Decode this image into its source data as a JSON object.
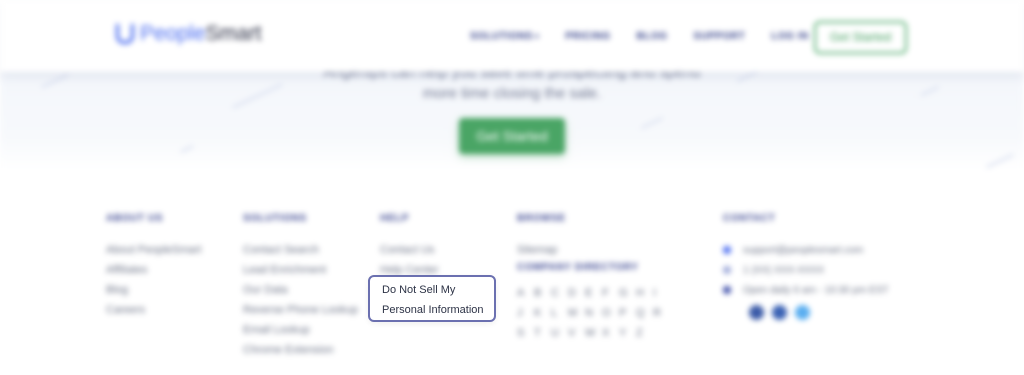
{
  "header": {
    "logo_people": "People",
    "logo_smart": "Smart",
    "nav": [
      "SOLUTIONS",
      "PRICING",
      "BLOG",
      "SUPPORT",
      "LOG IN"
    ],
    "nav_caret": "▾",
    "cta": "Get Started"
  },
  "hero": {
    "line1": "Angertips can help you save time prospecting and spend",
    "line2": "more time closing the sale.",
    "cta": "Get Started"
  },
  "footer": {
    "about": {
      "title": "ABOUT US",
      "links": [
        "About PeopleSmart",
        "Affiliates",
        "Blog",
        "Careers"
      ]
    },
    "solutions": {
      "title": "SOLUTIONS",
      "links": [
        "Contact Search",
        "Lead Enrichment",
        "Our Data",
        "Reverse Phone Lookup",
        "Email Lookup",
        "Chrome Extension"
      ]
    },
    "help": {
      "title": "HELP",
      "links": [
        "Contact Us",
        "Help Center"
      ]
    },
    "browse": {
      "title": "BROWSE",
      "links": [
        "Sitemap"
      ],
      "directory_title": "COMPANY DIRECTORY",
      "letters": [
        "A",
        "B",
        "C",
        "D",
        "E",
        "F",
        "G",
        "H",
        "I",
        "J",
        "K",
        "L",
        "M",
        "N",
        "O",
        "P",
        "Q",
        "R",
        "S",
        "T",
        "U",
        "V",
        "W",
        "X",
        "Y",
        "Z"
      ]
    },
    "contact": {
      "title": "CONTACT",
      "email": "support@peoplesmart.com",
      "phone": "1 (XX) XXX-XXXX",
      "hours": "Open daily 6 am - 10:30 pm EST"
    }
  },
  "tooltip": {
    "line1": "Do Not Sell My",
    "line2": "Personal Information"
  },
  "colors": {
    "brand_blue": "#4a6cf0",
    "nav_navy": "#2e3b86",
    "brand_green": "#4aa565"
  }
}
